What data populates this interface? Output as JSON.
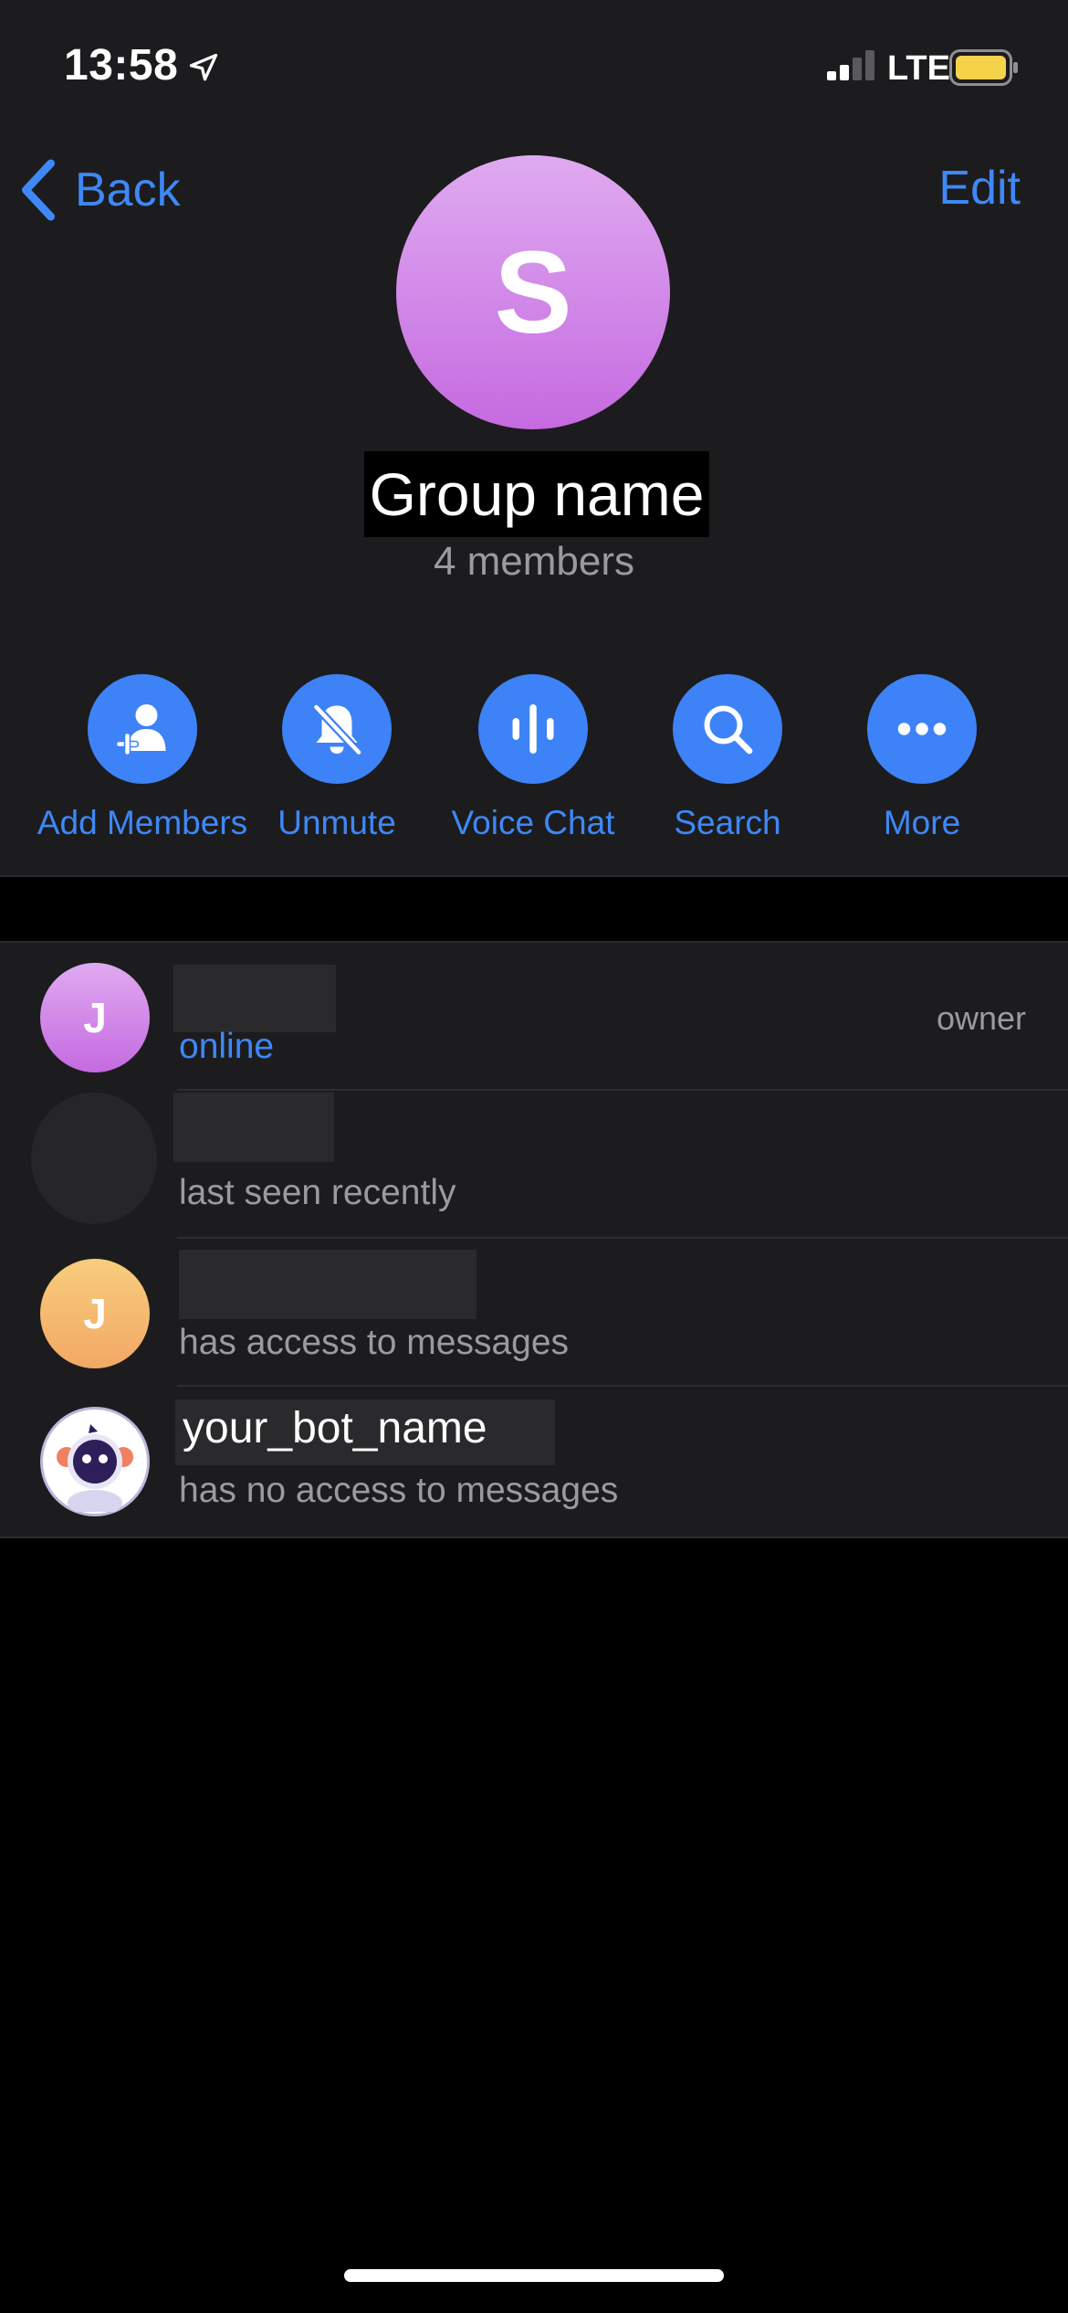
{
  "status_bar": {
    "time": "13:58",
    "network": "LTE",
    "location_icon": "location-arrow-icon",
    "signal_icon": "signal-bars-icon",
    "battery_icon": "battery-icon"
  },
  "nav": {
    "back_label": "Back",
    "edit_label": "Edit"
  },
  "group": {
    "avatar_letter": "S",
    "avatar_gradient": [
      "#dfaaf0",
      "#c56ae0"
    ],
    "name": "Group name",
    "member_count": "4 members"
  },
  "actions": [
    {
      "label": "Add Members",
      "icon": "add-member-icon"
    },
    {
      "label": "Unmute",
      "icon": "bell-slash-icon"
    },
    {
      "label": "Voice Chat",
      "icon": "voice-wave-icon"
    },
    {
      "label": "Search",
      "icon": "search-icon"
    },
    {
      "label": "More",
      "icon": "more-dots-icon"
    }
  ],
  "members": [
    {
      "avatar_letter": "J",
      "avatar_color": "#c56ae0",
      "name": "",
      "status": "online",
      "role": "owner"
    },
    {
      "avatar_letter": "",
      "avatar_color": "#262628",
      "name": "",
      "status": "last seen recently",
      "role": ""
    },
    {
      "avatar_letter": "J",
      "avatar_color": "#f2b267",
      "name": "",
      "status": "has access to messages",
      "role": ""
    },
    {
      "avatar_letter": "",
      "avatar_color": "#ffffff",
      "name": "your_bot_name",
      "status": "has no access to messages",
      "role": ""
    }
  ],
  "colors": {
    "accent": "#3e88f7",
    "panel": "#1c1c1e",
    "background": "#000000",
    "secondary_text": "#9a9a9f"
  }
}
